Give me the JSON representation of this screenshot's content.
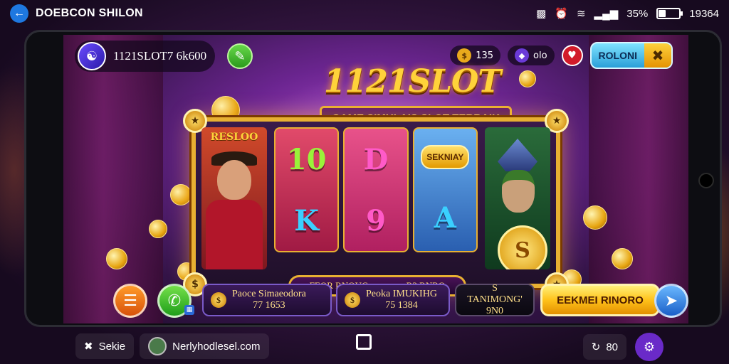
{
  "statusbar": {
    "app_title": "DOEBCON SHILON",
    "battery_text": "35%",
    "battery_level": 0.35,
    "time": "19364"
  },
  "hud": {
    "username": "1121SLOT7 6k600",
    "coins": "135",
    "gems": "olo",
    "pill_label": "ROLONI"
  },
  "game": {
    "logo": "1121SLOT",
    "subtitle": "GAME SIMULAIS SLOT TERBAIK",
    "left_panel_title": "RESLOO",
    "reel_symbols": [
      "10",
      "K",
      "D",
      "9",
      "SEKNIAY",
      "A"
    ],
    "footer_left": "FEOR RNOUG",
    "footer_right": "R3 RNRO",
    "big_coin": "S"
  },
  "actions": {
    "card_1_line1": "Paoce Simaeodora",
    "card_1_line2": "77 1653",
    "card_2_line1": "Peoka IMUKIHG",
    "card_2_line2": "75 1384",
    "card_3_line1": "S TANIMONG'",
    "card_3_line2": "9N0",
    "cta_label": "EEKMEI RINORO"
  },
  "navbar": {
    "left_label": "Sekie",
    "user_name": "Nerlyhodlesel.com",
    "right_value": "80"
  },
  "icons": {
    "back": "arrow-left-icon",
    "wifi": "wifi-icon",
    "signal": "signal-icon",
    "edit": "pencil-icon",
    "heart": "heart-icon",
    "close": "x-icon",
    "menu": "hamburger-icon",
    "call": "phone-icon",
    "fish": "fish-icon",
    "gear": "gear-icon"
  },
  "colors": {
    "accent_gold": "#e8b032",
    "screen_purple": "#6b2590",
    "back_button": "#1e78e0"
  }
}
